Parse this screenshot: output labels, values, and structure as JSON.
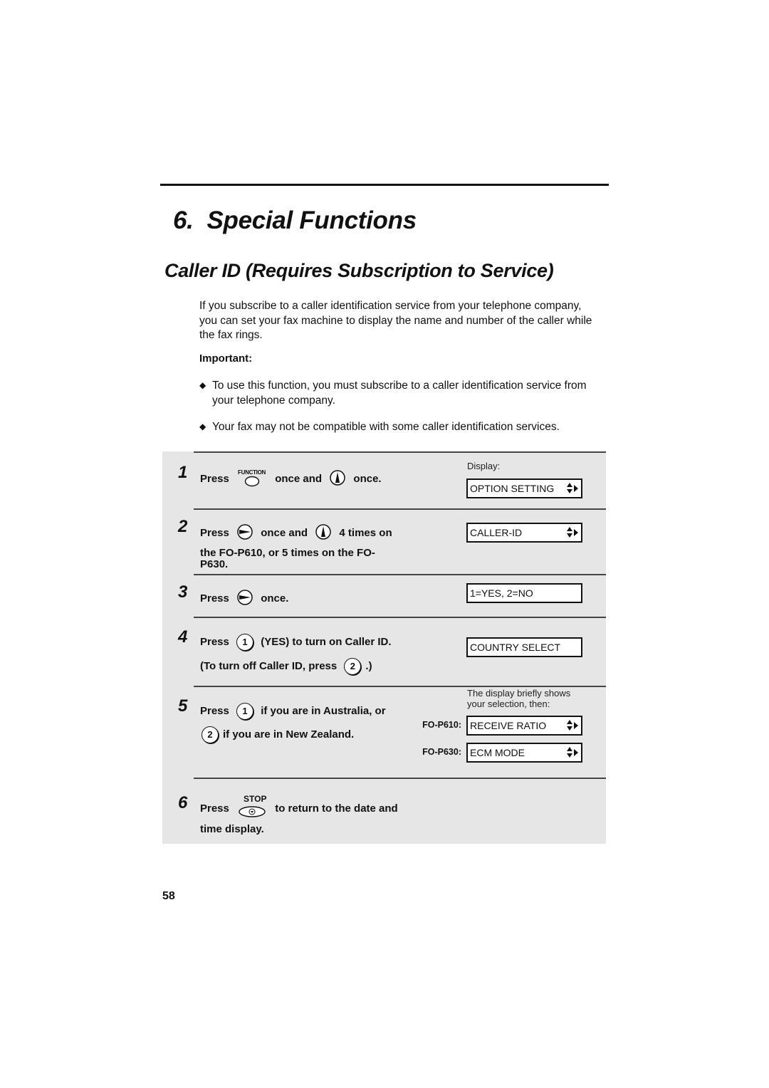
{
  "chapter": {
    "number": "6.",
    "title": "Special Functions"
  },
  "section": {
    "title": "Caller ID (Requires Subscription to Service)"
  },
  "intro": "If you subscribe to a caller identification service from your telephone company, you can set your fax machine to display the name and number of the caller while the fax rings.",
  "important": {
    "label": "Important:",
    "bullets": [
      "To use this function, you must subscribe to a caller identification service from your telephone company.",
      "Your fax may not be compatible with some caller identification services."
    ]
  },
  "steps": [
    {
      "number": "1",
      "parts": {
        "a": "Press",
        "key1_label": "FUNCTION",
        "b": "once and",
        "c": "once."
      },
      "display_label": "Display:",
      "display": "OPTION SETTING"
    },
    {
      "number": "2",
      "parts": {
        "a": "Press",
        "b": "once and",
        "c": "4 times on",
        "line2": "the FO-P610, or 5 times on the FO-",
        "line3": "P630."
      },
      "display": "CALLER-ID"
    },
    {
      "number": "3",
      "parts": {
        "a": "Press",
        "b": "once."
      },
      "display": "1=YES, 2=NO"
    },
    {
      "number": "4",
      "parts": {
        "a": "Press",
        "key1": "1",
        "b": "(YES) to turn on Caller ID.",
        "line2_a": "(To turn off Caller ID, press",
        "key2": "2",
        "line2_b": ".)"
      },
      "display": "COUNTRY SELECT"
    },
    {
      "number": "5",
      "parts": {
        "a": "Press",
        "key1": "1",
        "b": "if you are in Australia, or",
        "key2": "2",
        "line2": "if you are in New Zealand."
      },
      "display_note": "The display briefly shows your selection, then:",
      "displays": [
        {
          "model": "FO-P610:",
          "text": "RECEIVE RATIO"
        },
        {
          "model": "FO-P630:",
          "text": "ECM MODE"
        }
      ]
    },
    {
      "number": "6",
      "parts": {
        "a": "Press",
        "key_label": "STOP",
        "b": "to return to the date and",
        "line2": "time display."
      }
    }
  ],
  "page_number": "58"
}
